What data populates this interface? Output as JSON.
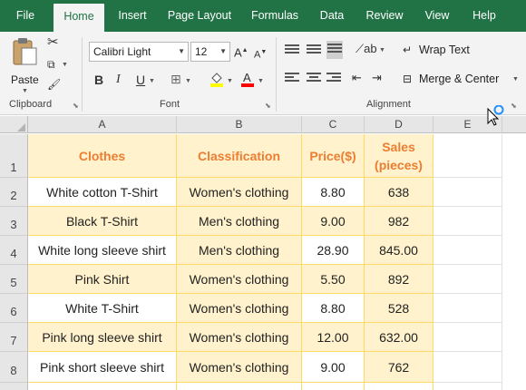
{
  "tabs": [
    "File",
    "Home",
    "Insert",
    "Page Layout",
    "Formulas",
    "Data",
    "Review",
    "View",
    "Help"
  ],
  "active_tab": "Home",
  "ribbon": {
    "clipboard": {
      "label": "Clipboard",
      "paste_label": "Paste"
    },
    "font": {
      "label": "Font",
      "font_name": "Calibri Light",
      "font_size": "12"
    },
    "alignment": {
      "label": "Alignment",
      "wrap_text": "Wrap Text",
      "merge_center": "Merge & Center"
    }
  },
  "grid": {
    "columns": [
      "A",
      "B",
      "C",
      "D",
      "E"
    ],
    "header_row": {
      "row_number": "1",
      "cells": [
        "Clothes",
        "Classification",
        "Price($)",
        "Sales (pieces)"
      ]
    },
    "rows": [
      {
        "row_number": "2",
        "cells": [
          "White cotton T-Shirt",
          "Women's clothing",
          "8.80",
          "638"
        ]
      },
      {
        "row_number": "3",
        "cells": [
          "Black T-Shirt",
          "Men's clothing",
          "9.00",
          "982"
        ]
      },
      {
        "row_number": "4",
        "cells": [
          "White long sleeve shirt",
          "Men's clothing",
          "28.90",
          "845.00"
        ]
      },
      {
        "row_number": "5",
        "cells": [
          "Pink Shirt",
          "Women's clothing",
          "5.50",
          "892"
        ]
      },
      {
        "row_number": "6",
        "cells": [
          "White T-Shirt",
          "Women's clothing",
          "8.80",
          "528"
        ]
      },
      {
        "row_number": "7",
        "cells": [
          "Pink long sleeve shirt",
          "Women's clothing",
          "12.00",
          "632.00"
        ]
      },
      {
        "row_number": "8",
        "cells": [
          "Pink short sleeve shirt",
          "Women's clothing",
          "9.00",
          "762"
        ]
      }
    ]
  },
  "colors": {
    "tab_bar": "#217346",
    "header_fill": "#fff2cc",
    "header_text": "#ed7d31",
    "cell_border": "#ffd966"
  }
}
